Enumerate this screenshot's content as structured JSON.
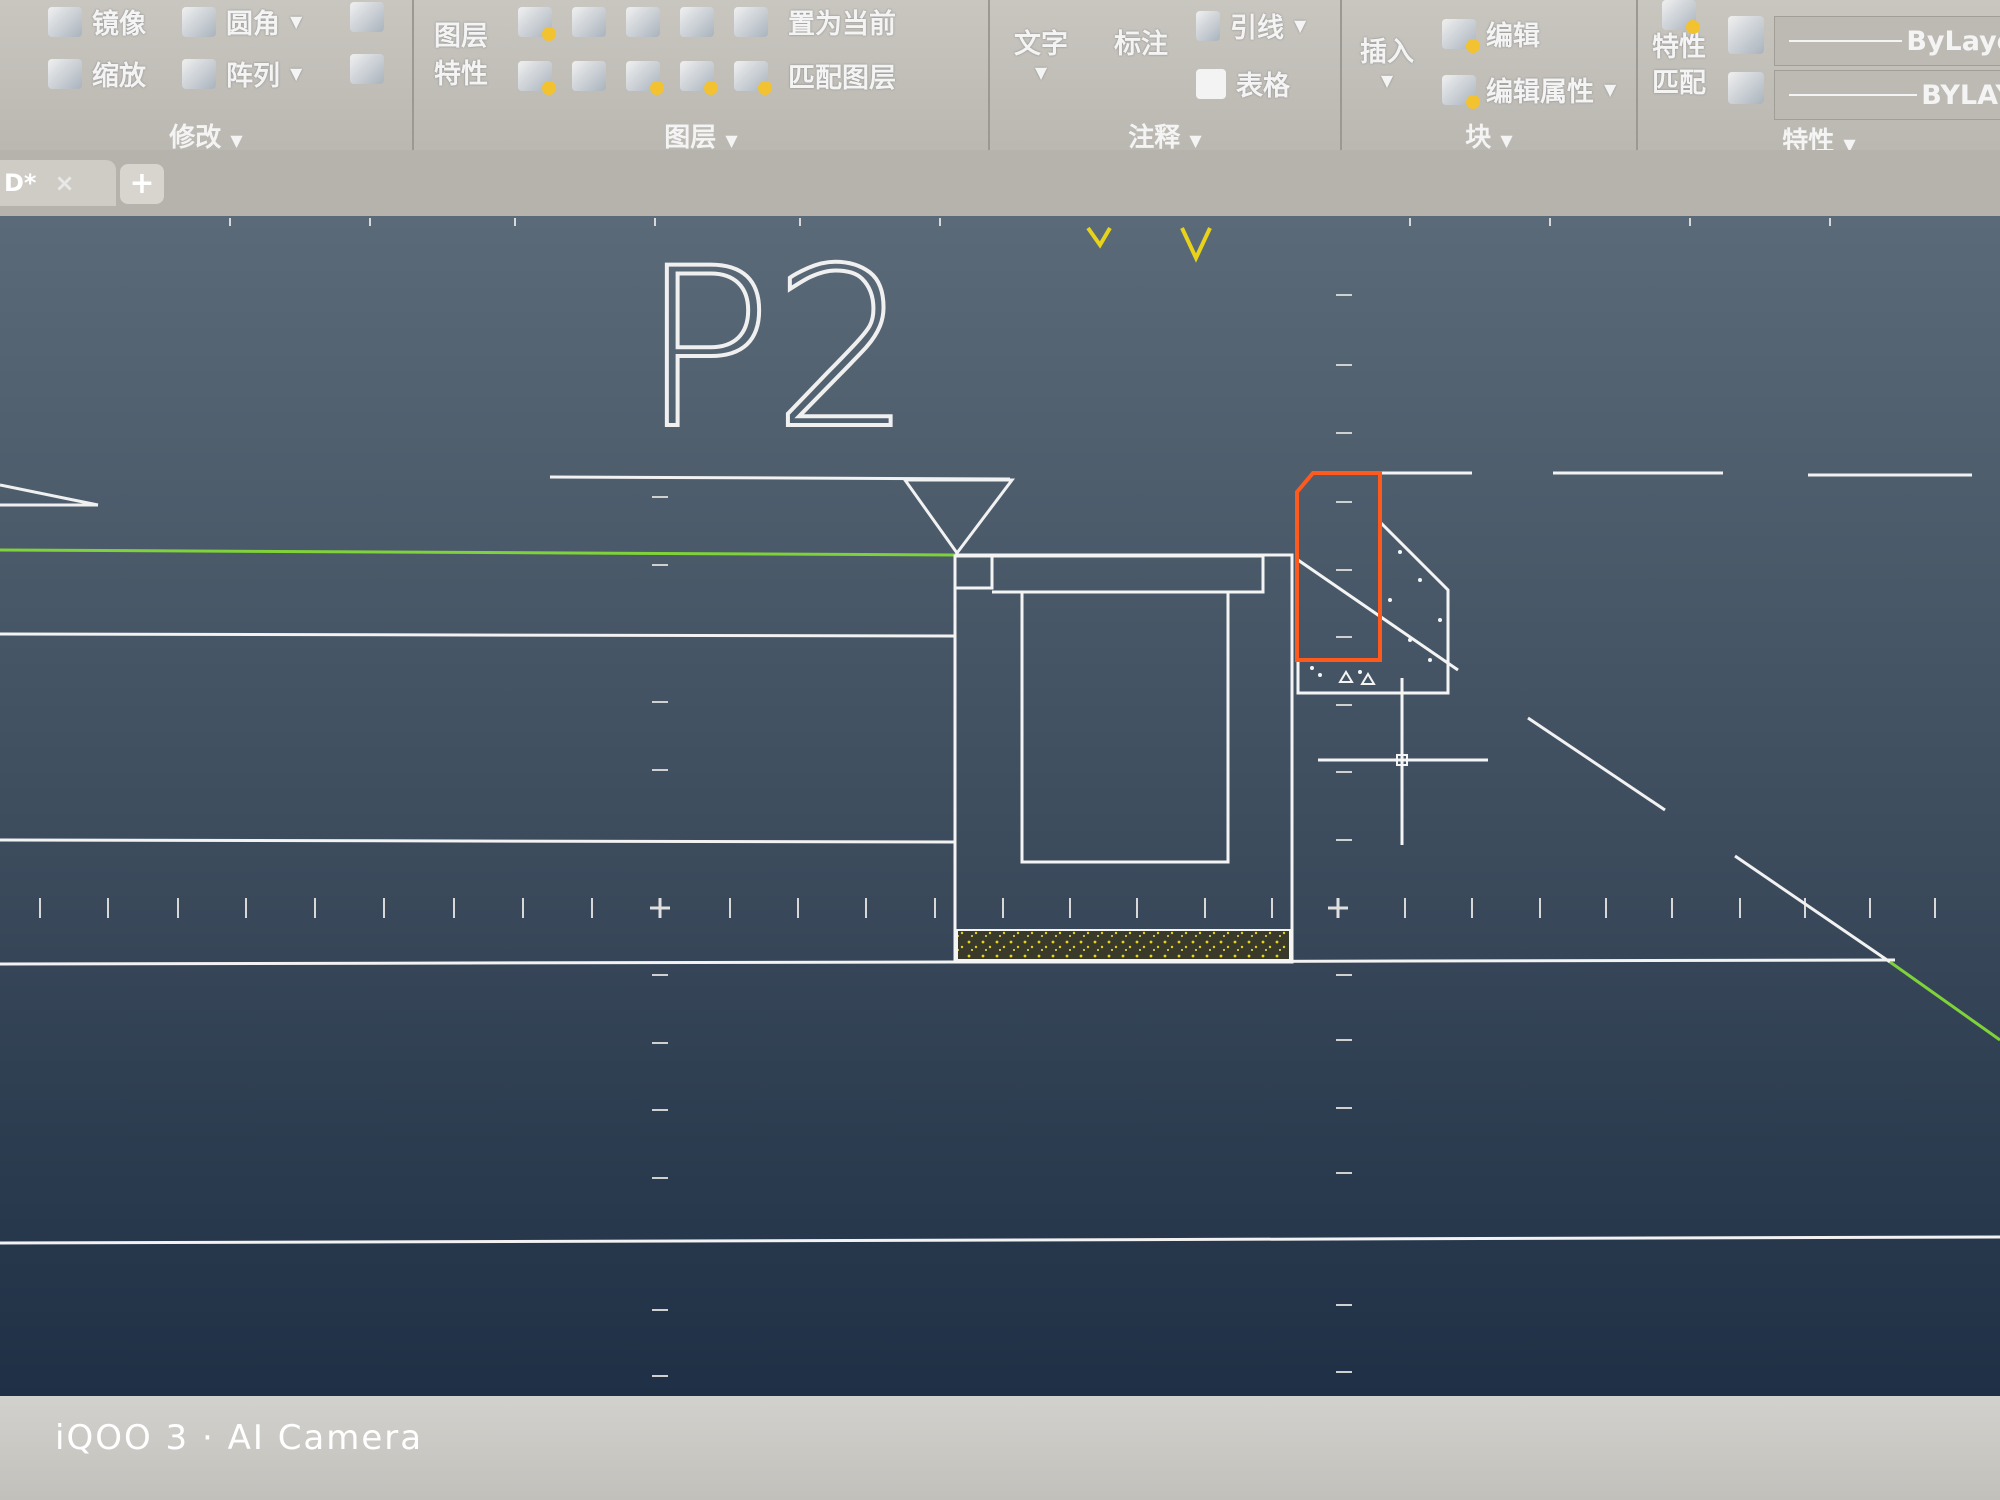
{
  "ribbon": {
    "modify": {
      "mirror": "镜像",
      "fillet": "圆角",
      "scale": "缩放",
      "array": "阵列",
      "title": "修改"
    },
    "layers": {
      "props_line1": "图层",
      "props_line2": "特性",
      "set_current": "置为当前",
      "match_layer": "匹配图层",
      "title": "图层"
    },
    "annotation": {
      "text": "文字",
      "dimension": "标注",
      "leader": "引线",
      "table": "表格",
      "title": "注释"
    },
    "block": {
      "insert": "插入",
      "edit": "编辑",
      "edit_attributes": "编辑属性",
      "title": "块"
    },
    "properties": {
      "match_line1": "特性",
      "match_line2": "匹配",
      "color_value": "ByLaye",
      "linetype_value": "BYLAY",
      "title": "特性"
    }
  },
  "tabs": {
    "current": "D*",
    "close_glyph": "×",
    "new_glyph": "+"
  },
  "drawing": {
    "label": "P2"
  },
  "watermark": "iQOO 3 · AI Camera",
  "colors": {
    "background": "#2e3d4d",
    "line": "#f2f2f2",
    "green": "#7fd23a",
    "orange": "#ff5a1e",
    "yellow": "#e8d21a"
  }
}
